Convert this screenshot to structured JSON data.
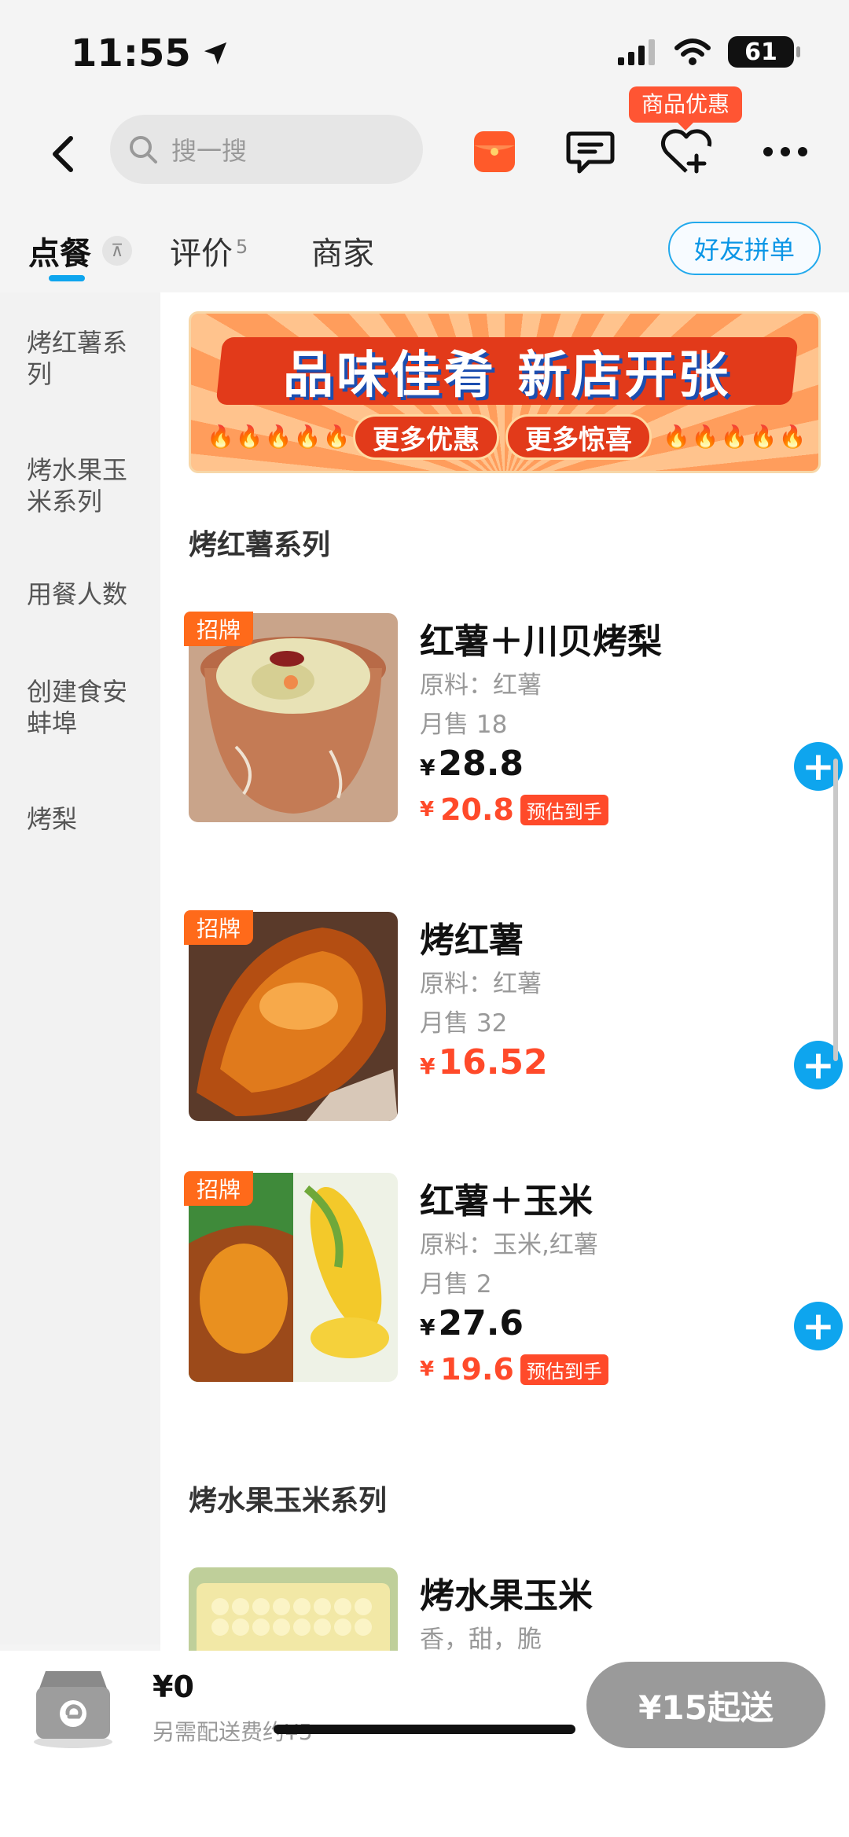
{
  "status_bar": {
    "time": "11:55",
    "battery": "61"
  },
  "header": {
    "search_placeholder": "搜一搜",
    "promo_tooltip": "商品优惠"
  },
  "tabs": [
    {
      "label": "点餐"
    },
    {
      "label": "评价",
      "count": "5"
    },
    {
      "label": "商家"
    }
  ],
  "friend_order_button": "好友拼单",
  "sidebar": {
    "items": [
      {
        "line1": "烤红薯系",
        "line2": "列"
      },
      {
        "line1": "烤水果玉",
        "line2": "米系列"
      },
      {
        "line1": "用餐人数",
        "line2": ""
      },
      {
        "line1": "创建食安",
        "line2": "蚌埠"
      },
      {
        "line1": "烤梨",
        "line2": ""
      }
    ]
  },
  "banner": {
    "title": "品味佳肴 新店开张",
    "pill_left": "更多优惠",
    "pill_right": "更多惊喜"
  },
  "sections": [
    {
      "title": "烤红薯系列"
    },
    {
      "title": "烤水果玉米系列"
    }
  ],
  "products": [
    {
      "tag": "招牌",
      "name": "红薯＋川贝烤梨",
      "desc": "原料：红薯",
      "sold": "月售 18",
      "currency": "¥",
      "price": "28.8",
      "est_price": "20.8",
      "est_label": "预估到手"
    },
    {
      "tag": "招牌",
      "name": "烤红薯",
      "desc": "原料：红薯",
      "sold": "月售 32",
      "currency": "¥",
      "price": "16.52"
    },
    {
      "tag": "招牌",
      "name": "红薯＋玉米",
      "desc": "原料：玉米,红薯",
      "sold": "月售 2",
      "currency": "¥",
      "price": "27.6",
      "est_price": "19.6",
      "est_label": "预估到手"
    },
    {
      "name": "烤水果玉米",
      "desc": "香，甜，脆"
    }
  ],
  "cart": {
    "total": "¥0",
    "delivery_fee": "另需配送费约¥5",
    "checkout": "¥15起送"
  },
  "colors": {
    "accent": "#0ea5ee",
    "price_red": "#ff4a2a",
    "tag_orange": "#ff6a1a"
  }
}
